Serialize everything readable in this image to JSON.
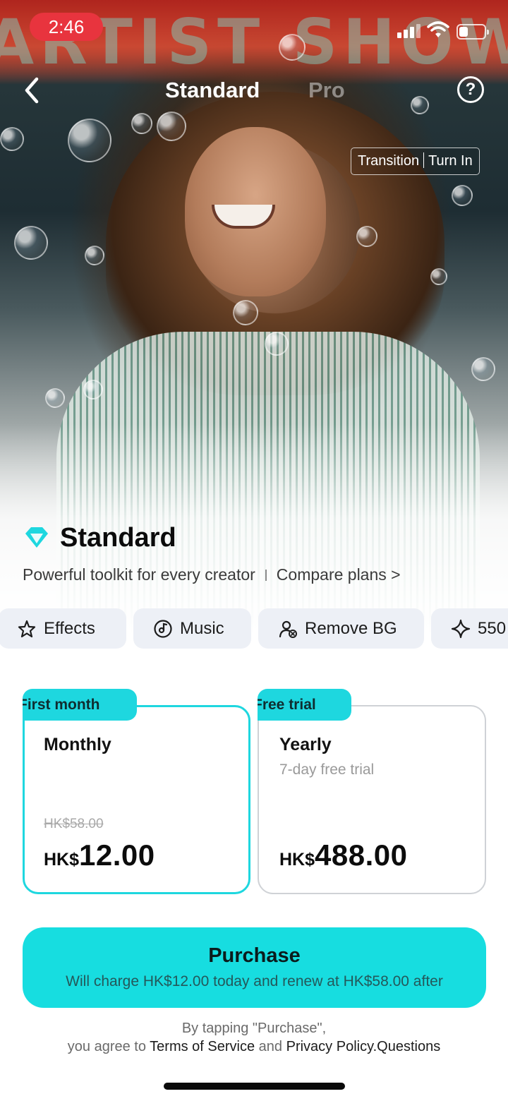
{
  "status_bar": {
    "time": "2:46",
    "battery_level": 0.35
  },
  "nav": {
    "tabs": [
      "Standard",
      "Pro"
    ],
    "active_tab": "Standard",
    "help_label": "?"
  },
  "hero": {
    "marquee_text": "ARTIST SHOW",
    "tag": {
      "left": "Transition",
      "right": "Turn In"
    }
  },
  "plan": {
    "title": "Standard",
    "subtitle": "Powerful toolkit for every creator",
    "compare_link": "Compare plans",
    "chevron": ">",
    "accent_color": "#1ed7df"
  },
  "features": [
    {
      "label": "Effects",
      "icon": "star-outline-icon"
    },
    {
      "label": "Music",
      "icon": "music-disc-icon"
    },
    {
      "label": "Remove BG",
      "icon": "person-remove-icon"
    },
    {
      "label": "550",
      "icon": "sparkle-icon"
    }
  ],
  "plans": {
    "monthly": {
      "badge": "First month",
      "title": "Monthly",
      "old_price": "HK$58.00",
      "currency": "HK$",
      "amount": "12.00",
      "selected": true
    },
    "yearly": {
      "badge": "Free trial",
      "title": "Yearly",
      "subtitle": "7-day free trial",
      "currency": "HK$",
      "amount": "488.00",
      "selected": false
    }
  },
  "purchase": {
    "label": "Purchase",
    "note": "Will charge HK$12.00 today and renew at HK$58.00 after",
    "color": "#17dde0"
  },
  "legal": {
    "line1": "By tapping \"Purchase\",",
    "prefix": "you agree to",
    "terms": "Terms of Service",
    "and": "and",
    "privacy": "Privacy Policy.",
    "questions": "Questions"
  }
}
